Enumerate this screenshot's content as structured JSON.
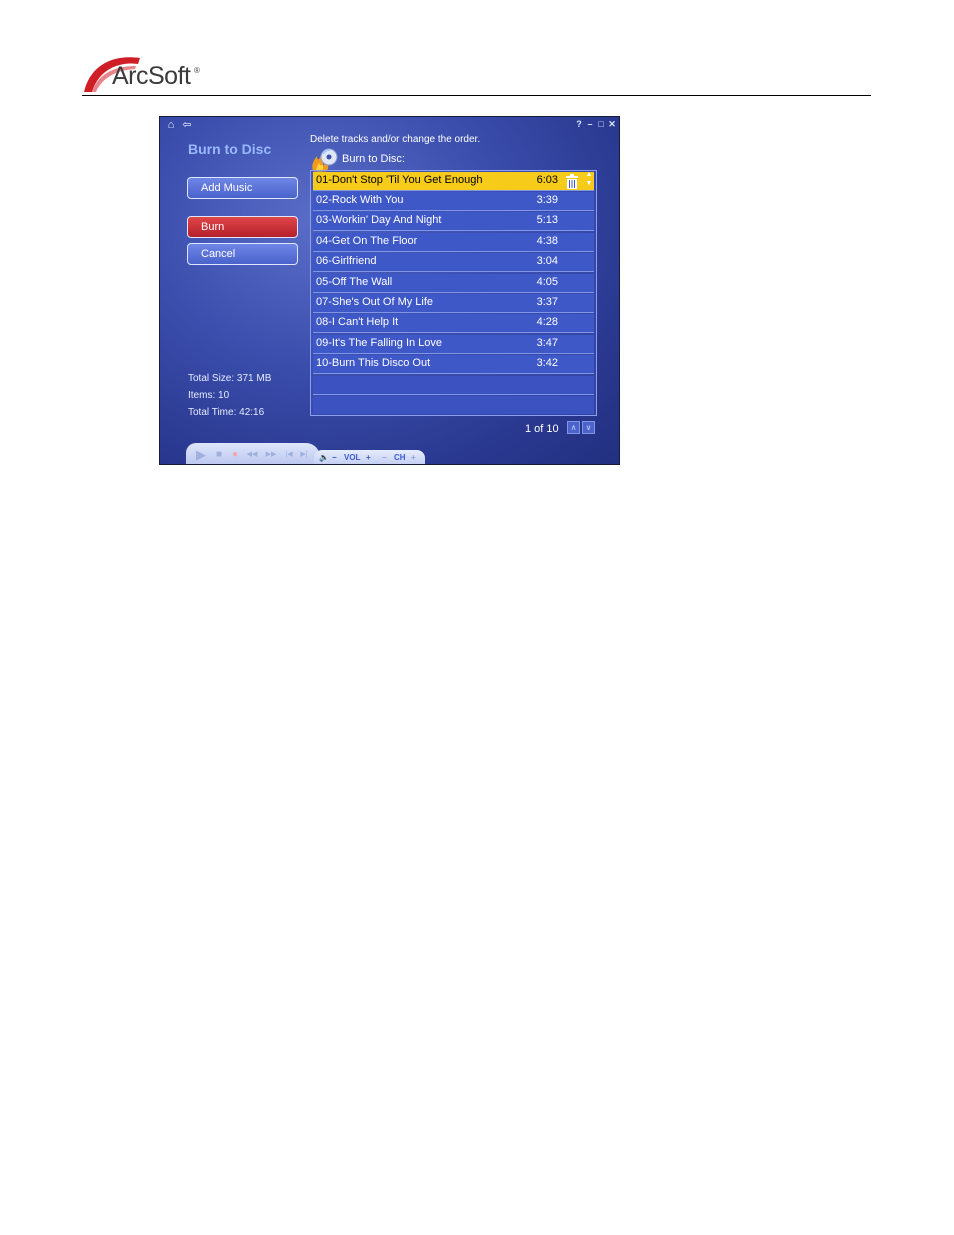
{
  "brand": {
    "name": "ArcSoft",
    "reg": "®"
  },
  "window": {
    "nav": {
      "home_icon": "⌂",
      "back_icon": "⇦"
    },
    "controls": {
      "help": "?",
      "minimize": "–",
      "maximize": "□",
      "close": "✕"
    },
    "panel_title": "Burn to Disc",
    "buttons": {
      "add_music": "Add Music",
      "burn": "Burn",
      "cancel": "Cancel"
    },
    "stats": {
      "total_size": "Total Size: 371 MB",
      "items": "Items: 10",
      "total_time": "Total Time: 42:16"
    },
    "instruction": "Delete tracks and/or change the order.",
    "list_title": "Burn to Disc:",
    "tracks": [
      {
        "name": "01-Don't Stop 'Til You Get Enough",
        "time": "6:03"
      },
      {
        "name": "02-Rock With You",
        "time": "3:39"
      },
      {
        "name": "03-Workin' Day And Night",
        "time": "5:13"
      },
      {
        "name": "04-Get On The Floor",
        "time": "4:38"
      },
      {
        "name": "06-Girlfriend",
        "time": "3:04"
      },
      {
        "name": "05-Off The Wall",
        "time": "4:05"
      },
      {
        "name": "07-She's Out Of My Life",
        "time": "3:37"
      },
      {
        "name": "08-I Can't Help It",
        "time": "4:28"
      },
      {
        "name": "09-It's The Falling In Love",
        "time": "3:47"
      },
      {
        "name": "10-Burn This Disco Out",
        "time": "3:42"
      }
    ],
    "row_icons": {
      "delete": "trash-icon",
      "up": "▲",
      "down": "▼"
    },
    "pagination": {
      "text": "1 of 10",
      "up": "∧",
      "down": "∨"
    },
    "transport": {
      "play": "▶",
      "stop": "■",
      "record": "●",
      "rewind": "◀◀",
      "forward": "▶▶",
      "prev": "|◀",
      "next": "▶|",
      "mute": "🔈",
      "vol_minus": "−",
      "vol_label": "VOL",
      "vol_plus": "+",
      "ch_minus": "−",
      "ch_label": "CH",
      "ch_plus": "+"
    },
    "colors": {
      "selected_row": "#f7cb1a",
      "burn_button": "#c8282e",
      "accent": "#3c4fae"
    }
  }
}
